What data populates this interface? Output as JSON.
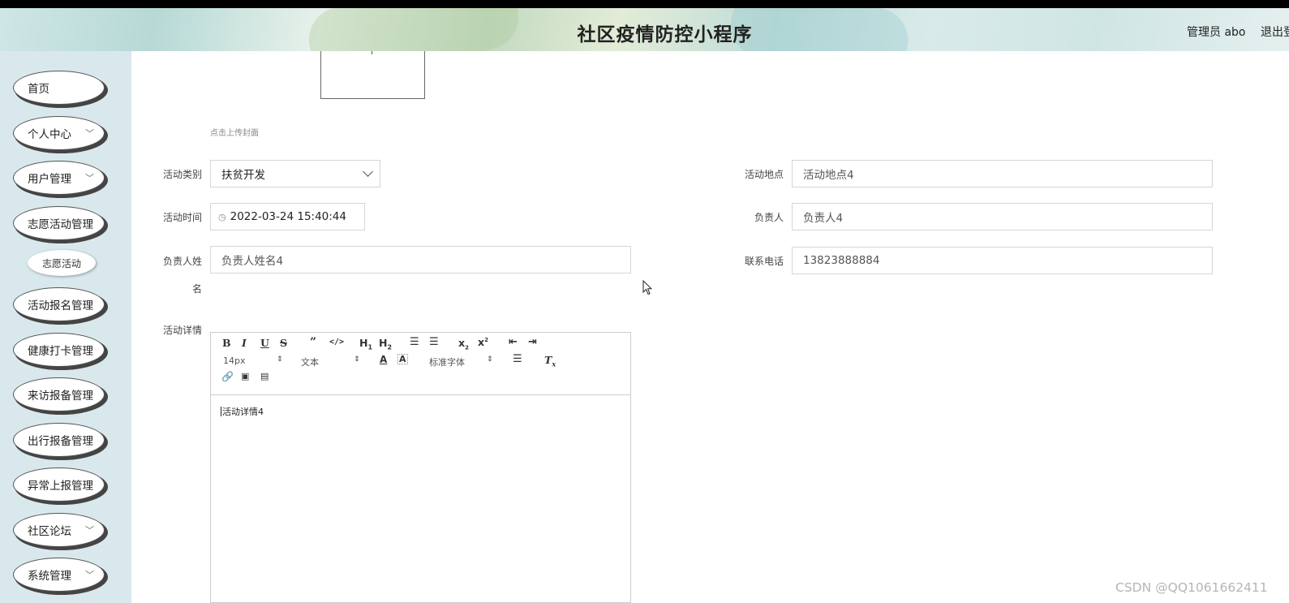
{
  "header": {
    "title": "社区疫情防控小程序",
    "admin_label": "管理员 abo",
    "logout_label": "退出登录"
  },
  "sidebar": {
    "items": [
      {
        "label": "首页",
        "chevron": false
      },
      {
        "label": "个人中心",
        "chevron": true
      },
      {
        "label": "用户管理",
        "chevron": true
      },
      {
        "label": "志愿活动管理",
        "chevron": false
      },
      {
        "label": "活动报名管理",
        "chevron": false
      },
      {
        "label": "健康打卡管理",
        "chevron": false
      },
      {
        "label": "来访报备管理",
        "chevron": false
      },
      {
        "label": "出行报备管理",
        "chevron": false
      },
      {
        "label": "异常上报管理",
        "chevron": false
      },
      {
        "label": "社区论坛",
        "chevron": true
      },
      {
        "label": "系统管理",
        "chevron": true
      }
    ],
    "sub_item": "志愿活动"
  },
  "form": {
    "cover_hint": "点击上传封面",
    "category": {
      "label": "活动类别",
      "value": "扶贫开发"
    },
    "time": {
      "label": "活动时间",
      "value": "2022-03-24 15:40:44"
    },
    "contact_name": {
      "label_line1": "负责人姓",
      "label_line2": "名",
      "value": "负责人姓名4"
    },
    "location": {
      "label": "活动地点",
      "value": "活动地点4"
    },
    "person": {
      "label": "负责人",
      "value": "负责人4"
    },
    "phone": {
      "label": "联系电话",
      "value": "13823888884"
    },
    "details": {
      "label": "活动详情",
      "content": "活动详情4"
    }
  },
  "editor_toolbar": {
    "font_size": "14px",
    "text_style": "文本",
    "font_family": "标准字体"
  },
  "watermark": "CSDN @QQ1061662411"
}
